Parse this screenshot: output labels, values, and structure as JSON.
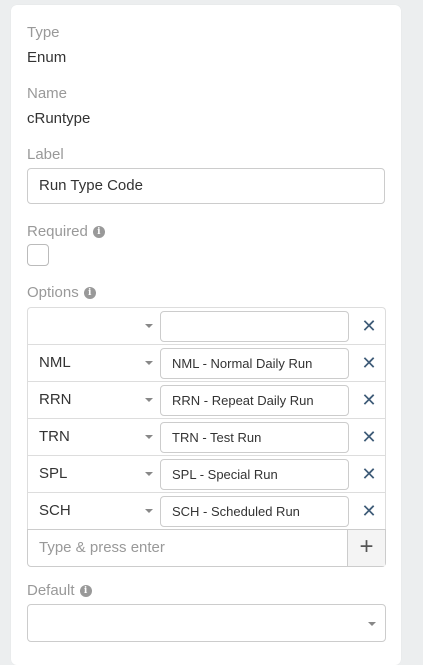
{
  "type": {
    "label": "Type",
    "value": "Enum"
  },
  "name": {
    "label": "Name",
    "value": "cRuntype"
  },
  "label_field": {
    "label": "Label",
    "value": "Run Type Code"
  },
  "required": {
    "label": "Required",
    "checked": false
  },
  "options": {
    "label": "Options",
    "rows": [
      {
        "value": "",
        "label": ""
      },
      {
        "value": "NML",
        "label": "NML - Normal Daily Run"
      },
      {
        "value": "RRN",
        "label": "RRN - Repeat Daily Run"
      },
      {
        "value": "TRN",
        "label": "TRN - Test Run"
      },
      {
        "value": "SPL",
        "label": "SPL - Special Run"
      },
      {
        "value": "SCH",
        "label": "SCH - Scheduled Run"
      }
    ],
    "add_placeholder": "Type & press enter"
  },
  "default": {
    "label": "Default",
    "value": ""
  },
  "colors": {
    "remove_icon": "#3e5b77",
    "muted_label": "#999999"
  },
  "icons": {
    "info": "info-icon",
    "remove": "close-icon",
    "add": "plus-icon",
    "caret": "caret-down-icon"
  }
}
